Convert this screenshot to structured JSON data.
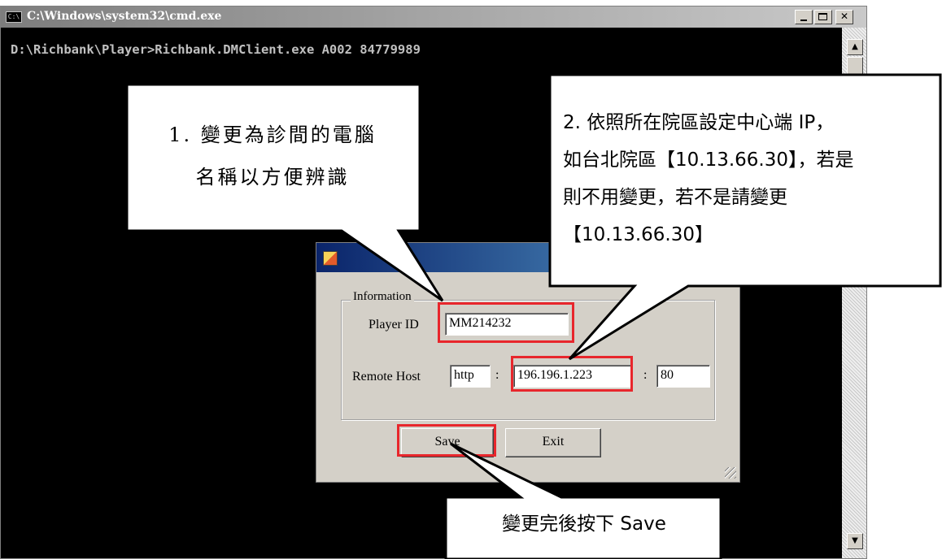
{
  "cmd": {
    "icon_label": "C:\\",
    "title": "C:\\Windows\\system32\\cmd.exe",
    "command_line": "D:\\Richbank\\Player>Richbank.DMClient.exe A002 84779989"
  },
  "dialog": {
    "group_label": "Information",
    "player_id_label": "Player ID",
    "player_id_value": "MM214232",
    "remote_host_label": "Remote Host",
    "protocol_value": "http",
    "separator": ":",
    "host_value": "196.196.1.223",
    "port_value": "80",
    "save_label": "Save",
    "exit_label": "Exit"
  },
  "callouts": {
    "c1_line1": "1. 變更為診間的電腦",
    "c1_line2": "名稱以方便辨識",
    "c2_line1": "2. 依照所在院區設定中心端 IP，",
    "c2_line2": "如台北院區【10.13.66.30】，若是",
    "c2_line3": "則不用變更，若不是請變更",
    "c2_line4": "【10.13.66.30】",
    "c3_text": "變更完後按下 Save"
  },
  "colors": {
    "highlight": "#e8262c",
    "console_bg": "#000000",
    "dialog_bg": "#d4d0c8"
  }
}
